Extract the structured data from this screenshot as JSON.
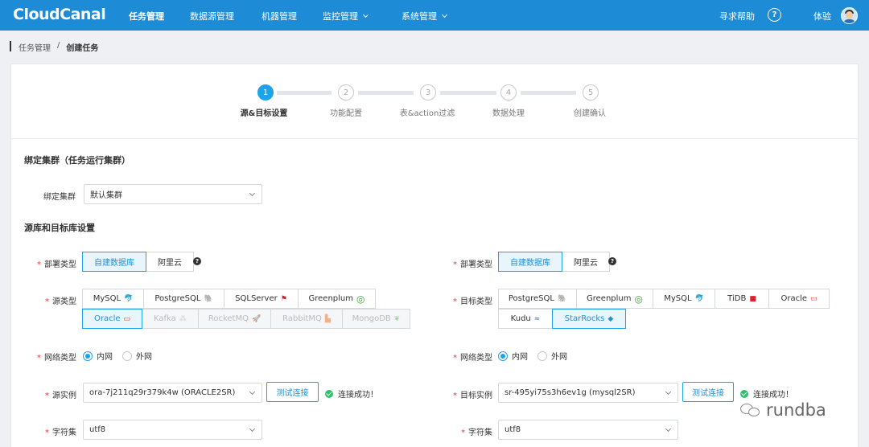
{
  "header": {
    "logo": "CloudCanal",
    "nav": [
      "任务管理",
      "数据源管理",
      "机器管理",
      "监控管理",
      "系统管理"
    ],
    "help": "寻求帮助",
    "help_icon": "?",
    "user": "体验"
  },
  "breadcrumb": {
    "root": "任务管理",
    "sep": "/",
    "current": "创建任务"
  },
  "steps": [
    {
      "num": "1",
      "label": "源&目标设置"
    },
    {
      "num": "2",
      "label": "功能配置"
    },
    {
      "num": "3",
      "label": "表&action过滤"
    },
    {
      "num": "4",
      "label": "数据处理"
    },
    {
      "num": "5",
      "label": "创建确认"
    }
  ],
  "cluster": {
    "section_title": "绑定集群（任务运行集群）",
    "label": "绑定集群",
    "value": "默认集群"
  },
  "db_section_title": "源库和目标库设置",
  "source": {
    "deploy_label": "部署类型",
    "deploy_options": [
      "自建数据库",
      "阿里云"
    ],
    "type_label": "源类型",
    "types_row1": [
      {
        "name": "MySQL",
        "icon": "mysql-icon"
      },
      {
        "name": "PostgreSQL",
        "icon": "postgresql-icon"
      },
      {
        "name": "SQLServer",
        "icon": "sqlserver-icon"
      },
      {
        "name": "Greenplum",
        "icon": "greenplum-icon"
      }
    ],
    "types_row2": [
      {
        "name": "Oracle",
        "icon": "oracle-icon"
      },
      {
        "name": "Kafka",
        "icon": "kafka-icon"
      },
      {
        "name": "RocketMQ",
        "icon": "rocketmq-icon"
      },
      {
        "name": "RabbitMQ",
        "icon": "rabbitmq-icon"
      },
      {
        "name": "MongoDB",
        "icon": "mongodb-icon"
      }
    ],
    "net_label": "网络类型",
    "net_options": [
      "内网",
      "外网"
    ],
    "instance_label": "源实例",
    "instance_value": "ora-7j211q29r379k4w (ORACLE2SR)",
    "test_button": "测试连接",
    "status": "连接成功！",
    "charset_label": "字符集",
    "charset_value": "utf8"
  },
  "target": {
    "deploy_label": "部署类型",
    "deploy_options": [
      "自建数据库",
      "阿里云"
    ],
    "type_label": "目标类型",
    "types_row1": [
      {
        "name": "PostgreSQL",
        "icon": "postgresql-icon"
      },
      {
        "name": "Greenplum",
        "icon": "greenplum-icon"
      },
      {
        "name": "MySQL",
        "icon": "mysql-icon"
      },
      {
        "name": "TiDB",
        "icon": "tidb-icon"
      },
      {
        "name": "Oracle",
        "icon": "oracle-icon"
      }
    ],
    "types_row2": [
      {
        "name": "Kudu",
        "icon": "kudu-icon"
      },
      {
        "name": "StarRocks",
        "icon": "starrocks-icon"
      }
    ],
    "net_label": "网络类型",
    "net_options": [
      "内网",
      "外网"
    ],
    "instance_label": "目标实例",
    "instance_value": "sr-495yi75s3h6ev1g (mysql2SR)",
    "test_button": "测试连接",
    "status": "连接成功！",
    "charset_label": "字符集",
    "charset_value": "utf8"
  },
  "required_mark": "*",
  "help_mark": "?",
  "watermark": "rundba",
  "colors": {
    "header": "#1d8bd6",
    "accent": "#1ea2ea",
    "success": "#2ec26b",
    "required": "#e5393d"
  }
}
